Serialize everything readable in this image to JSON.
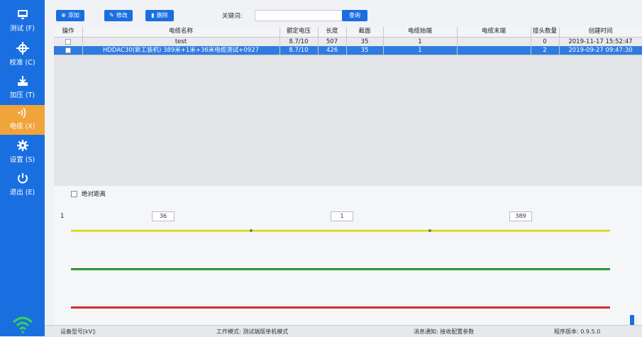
{
  "sidebar": {
    "items": [
      {
        "label": "测试 (F)",
        "icon": "monitor-icon"
      },
      {
        "label": "校准 (C)",
        "icon": "crosshair-icon"
      },
      {
        "label": "加压 (T)",
        "icon": "download-icon"
      },
      {
        "label": "电缆 (X)",
        "icon": "signal-icon",
        "active": true
      },
      {
        "label": "设置 (S)",
        "icon": "gear-icon"
      },
      {
        "label": "退出 (E)",
        "icon": "power-icon"
      }
    ]
  },
  "toolbar": {
    "add_label": "添加",
    "edit_label": "修改",
    "delete_label": "删除",
    "keyword_label": "关键词:",
    "keyword_value": "",
    "query_label": "查询"
  },
  "table": {
    "columns": [
      "操作",
      "电缆名称",
      "额定电压",
      "长度",
      "截面",
      "电缆始端",
      "电缆末端",
      "接头数量",
      "创建时间"
    ],
    "rows": [
      [
        "",
        "test",
        "8.7/10",
        "507",
        "35",
        "1",
        "",
        "0",
        "2019-11-17 15:52:47"
      ],
      [
        "",
        "HDDAC30(新工装机) 389米+1米+36米电缆测试+0927",
        "8.7/10",
        "426",
        "35",
        "1",
        "",
        "2",
        "2019-09-27 09:47:30"
      ]
    ]
  },
  "lower": {
    "absolute_distance_label": "绝对距离",
    "row_number": "1",
    "segments": [
      "36",
      "1",
      "389"
    ]
  },
  "statusbar": {
    "device": "设备型号[kV]:",
    "work_mode": "工作模式: 测试端版单机模式",
    "message": "消息通知: 接收配置参数",
    "version": "程序版本: 0.9.5.0"
  },
  "colors": {
    "sidebar_bg": "#1a6fe0",
    "active_item": "#f0a43a",
    "selected_row": "#2f7ce0",
    "cable_yellow": "#e6e63a",
    "cable_green": "#2ea23a",
    "cable_red": "#e03434"
  }
}
